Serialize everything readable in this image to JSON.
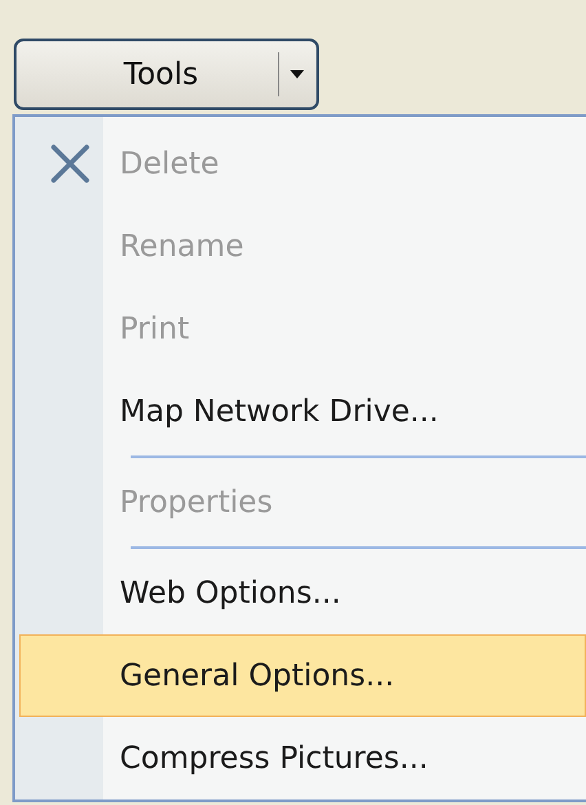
{
  "button": {
    "label": "Tools"
  },
  "menu": {
    "items": [
      {
        "kind": "item",
        "label": "Delete",
        "disabled": true,
        "selected": false
      },
      {
        "kind": "item",
        "label": "Rename",
        "disabled": true,
        "selected": false
      },
      {
        "kind": "item",
        "label": "Print",
        "disabled": true,
        "selected": false
      },
      {
        "kind": "item",
        "label": "Map Network Drive...",
        "disabled": false,
        "selected": false
      },
      {
        "kind": "separator"
      },
      {
        "kind": "item",
        "label": "Properties",
        "disabled": true,
        "selected": false
      },
      {
        "kind": "separator"
      },
      {
        "kind": "item",
        "label": "Web Options...",
        "disabled": false,
        "selected": false
      },
      {
        "kind": "item",
        "label": "General Options...",
        "disabled": false,
        "selected": true
      },
      {
        "kind": "item",
        "label": "Compress Pictures...",
        "disabled": false,
        "selected": false
      }
    ]
  }
}
